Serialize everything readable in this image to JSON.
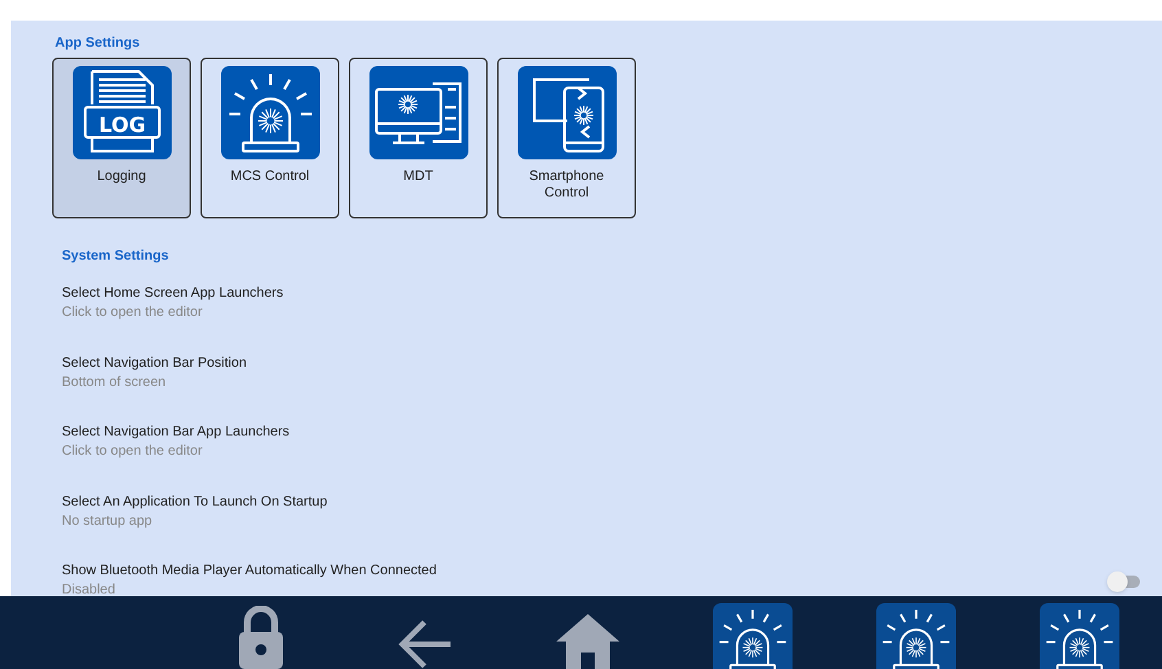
{
  "app_settings": {
    "title": "App Settings",
    "tiles": [
      {
        "label": "Logging",
        "kind": "log",
        "icon_text": "LOG",
        "selected": true
      },
      {
        "label": "MCS Control",
        "kind": "siren",
        "selected": false
      },
      {
        "label": "MDT",
        "kind": "computer",
        "selected": false
      },
      {
        "label": "Smartphone Control",
        "kind": "phone",
        "selected": false
      }
    ]
  },
  "system_settings": {
    "title": "System Settings",
    "items": [
      {
        "title": "Select Home Screen App Launchers",
        "subtitle": "Click to open the editor"
      },
      {
        "title": "Select Navigation Bar Position",
        "subtitle": "Bottom of screen"
      },
      {
        "title": "Select Navigation Bar App Launchers",
        "subtitle": "Click to open the editor"
      },
      {
        "title": "Select An Application To Launch On Startup",
        "subtitle": "No startup app"
      },
      {
        "title": "Show Bluetooth Media Player Automatically When Connected",
        "subtitle": "Disabled",
        "kind": "toggle",
        "on": false
      }
    ]
  },
  "nav_bar": {
    "items": [
      {
        "kind": "lock"
      },
      {
        "kind": "back"
      },
      {
        "kind": "home"
      },
      {
        "kind": "siren"
      },
      {
        "kind": "siren"
      },
      {
        "kind": "siren"
      }
    ]
  }
}
